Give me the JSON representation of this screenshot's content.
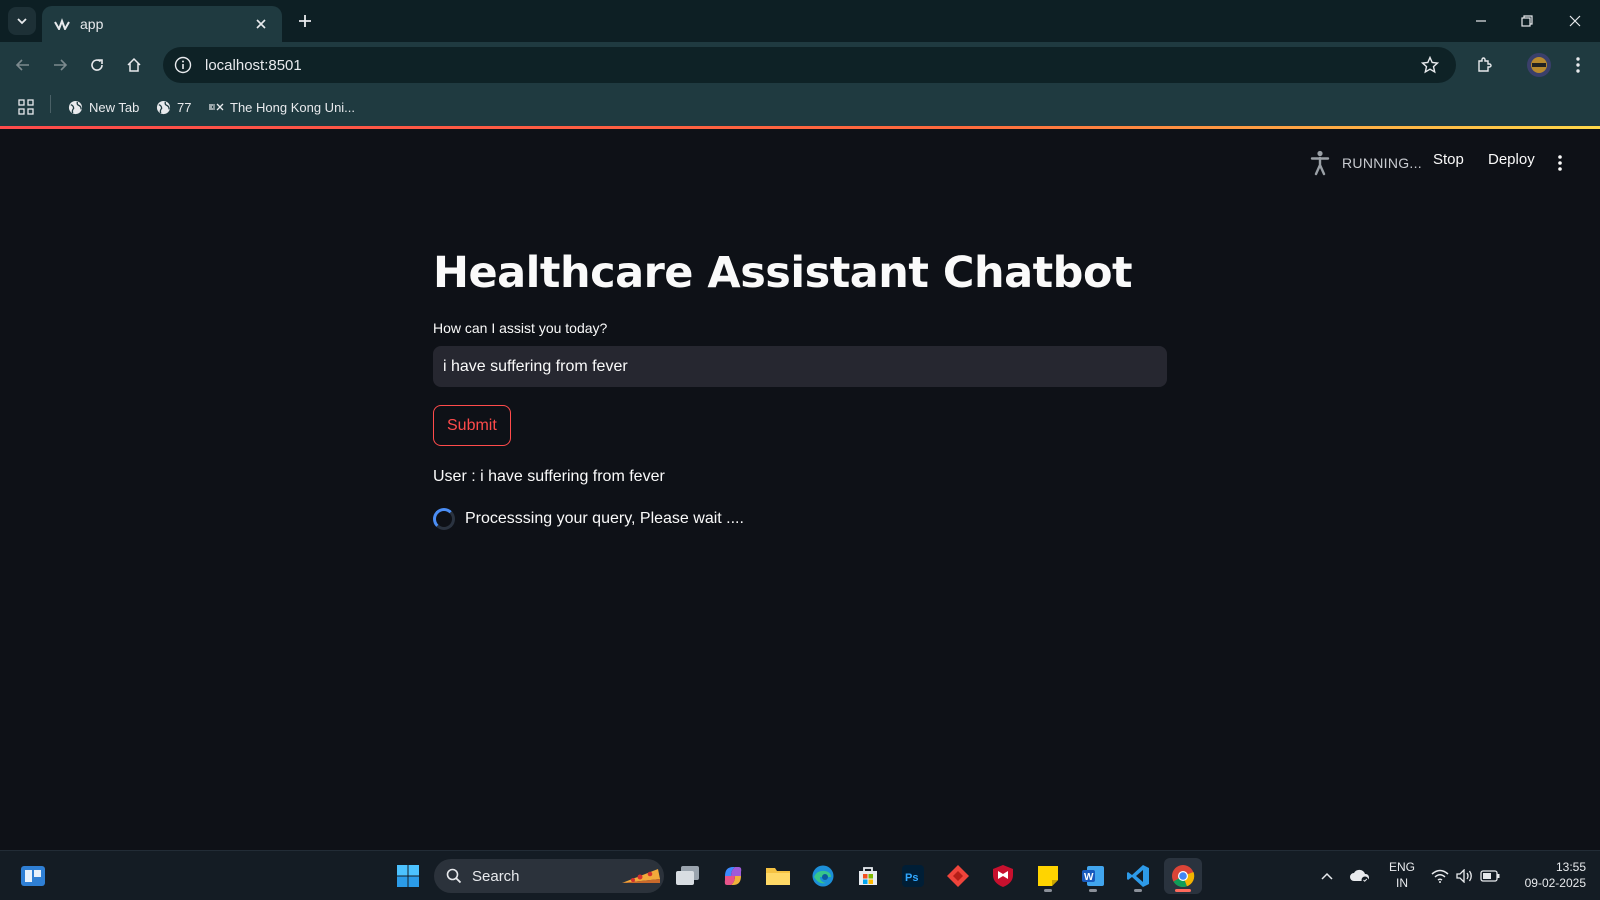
{
  "browser": {
    "tab_title": "app",
    "url": "localhost:8501",
    "bookmarks": [
      {
        "label": "New Tab",
        "icon": "globe-icon"
      },
      {
        "label": "77",
        "icon": "globe-icon"
      },
      {
        "label": "The Hong Kong Uni...",
        "icon": "edx-icon"
      }
    ]
  },
  "app_header": {
    "status": "RUNNING...",
    "stop_label": "Stop",
    "deploy_label": "Deploy"
  },
  "main": {
    "title": "Healthcare Assistant Chatbot",
    "input_label": "How can I assist you today?",
    "input_value": "i have suffering from fever",
    "submit_label": "Submit",
    "user_message": "User : i have suffering from fever",
    "spinner_text": "Processsing your query, Please wait ...."
  },
  "taskbar": {
    "search_label": "Search",
    "lang_line1": "ENG",
    "lang_line2": "IN",
    "time": "13:55",
    "date": "09-02-2025"
  },
  "colors": {
    "background": "#0e1117",
    "accent": "#ff4b4b",
    "input_bg": "#262730",
    "browser_chrome": "#1f3a40"
  }
}
